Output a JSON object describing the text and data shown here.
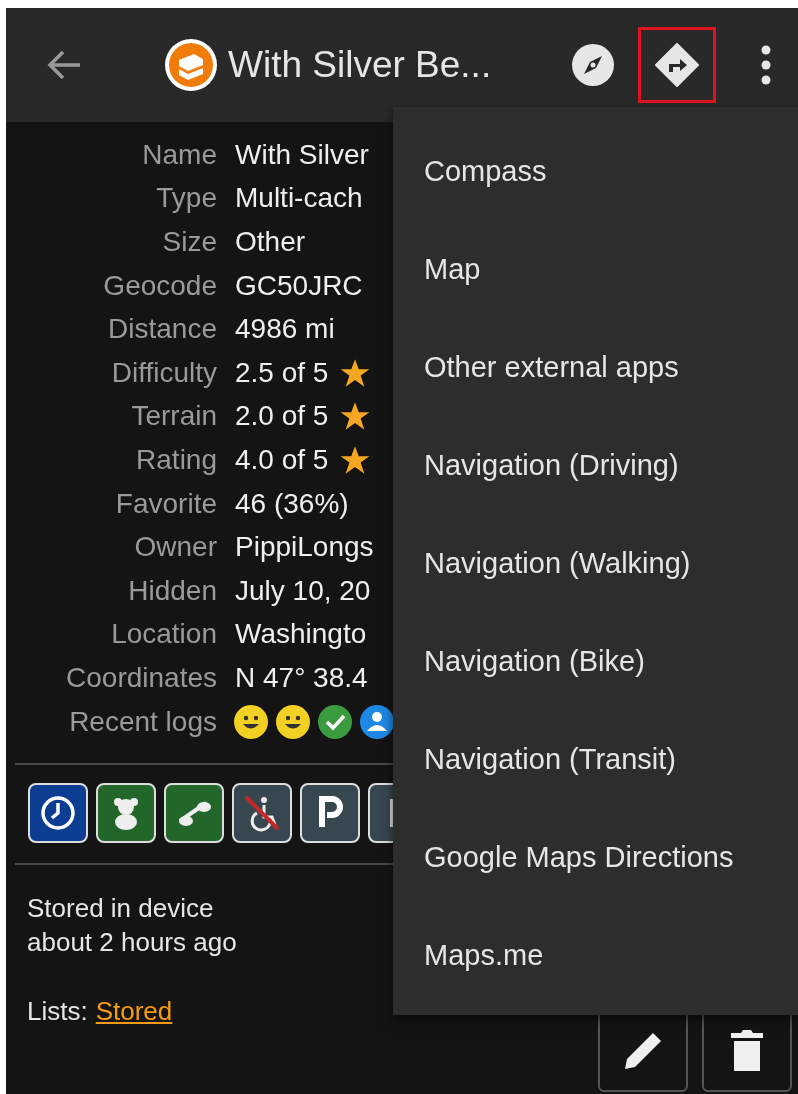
{
  "app_bar": {
    "title": "With Silver Be...",
    "actions": [
      {
        "kind": "compass",
        "highlighted": false
      },
      {
        "kind": "directions",
        "highlighted": true
      },
      {
        "kind": "more",
        "highlighted": false
      }
    ]
  },
  "details": [
    {
      "label": "Name",
      "value": "With Silver"
    },
    {
      "label": "Type",
      "value": "Multi-cach"
    },
    {
      "label": "Size",
      "value": "Other"
    },
    {
      "label": "Geocode",
      "value": "GC50JRC"
    },
    {
      "label": "Distance",
      "value": "4986 mi"
    },
    {
      "label": "Difficulty",
      "value": "2.5 of 5",
      "kind": "rating"
    },
    {
      "label": "Terrain",
      "value": "2.0 of 5",
      "kind": "rating"
    },
    {
      "label": "Rating",
      "value": "4.0 of 5",
      "kind": "rating"
    },
    {
      "label": "Favorite",
      "value": "46 (36%)"
    },
    {
      "label": "Owner",
      "value": "PippiLongs"
    },
    {
      "label": "Hidden",
      "value": "July 10, 20"
    },
    {
      "label": "Location",
      "value": "Washingto"
    },
    {
      "label": "Coordinates",
      "value": "N 47° 38.4"
    },
    {
      "label": "Recent logs",
      "logs": [
        {
          "kind": "found",
          "color": "#f2d024"
        },
        {
          "kind": "found",
          "color": "#f2d024"
        },
        {
          "kind": "check",
          "color": "#3a9c3f"
        },
        {
          "kind": "person",
          "color": "#1e88e5"
        }
      ]
    }
  ],
  "attributes": [
    {
      "kind": "clock",
      "color": "#0d3d91"
    },
    {
      "kind": "teddy",
      "color": "#22662a"
    },
    {
      "kind": "glasses",
      "color": "#22662a"
    },
    {
      "kind": "wheelchair-no",
      "color": "#37474f"
    },
    {
      "kind": "parking",
      "color": "#37474f"
    },
    {
      "kind": "other",
      "color": "#37474f"
    }
  ],
  "storage": {
    "line_1": "Stored in device",
    "line_2": "about 2 hours ago",
    "lists_label": "Lists:",
    "list_link": "Stored"
  },
  "buttons": [
    {
      "kind": "edit"
    },
    {
      "kind": "delete"
    }
  ],
  "menu": {
    "items": [
      "Compass",
      "Map",
      "Other external apps",
      "Navigation (Driving)",
      "Navigation (Walking)",
      "Navigation (Bike)",
      "Navigation (Transit)",
      "Google Maps Directions",
      "Maps.me"
    ]
  }
}
